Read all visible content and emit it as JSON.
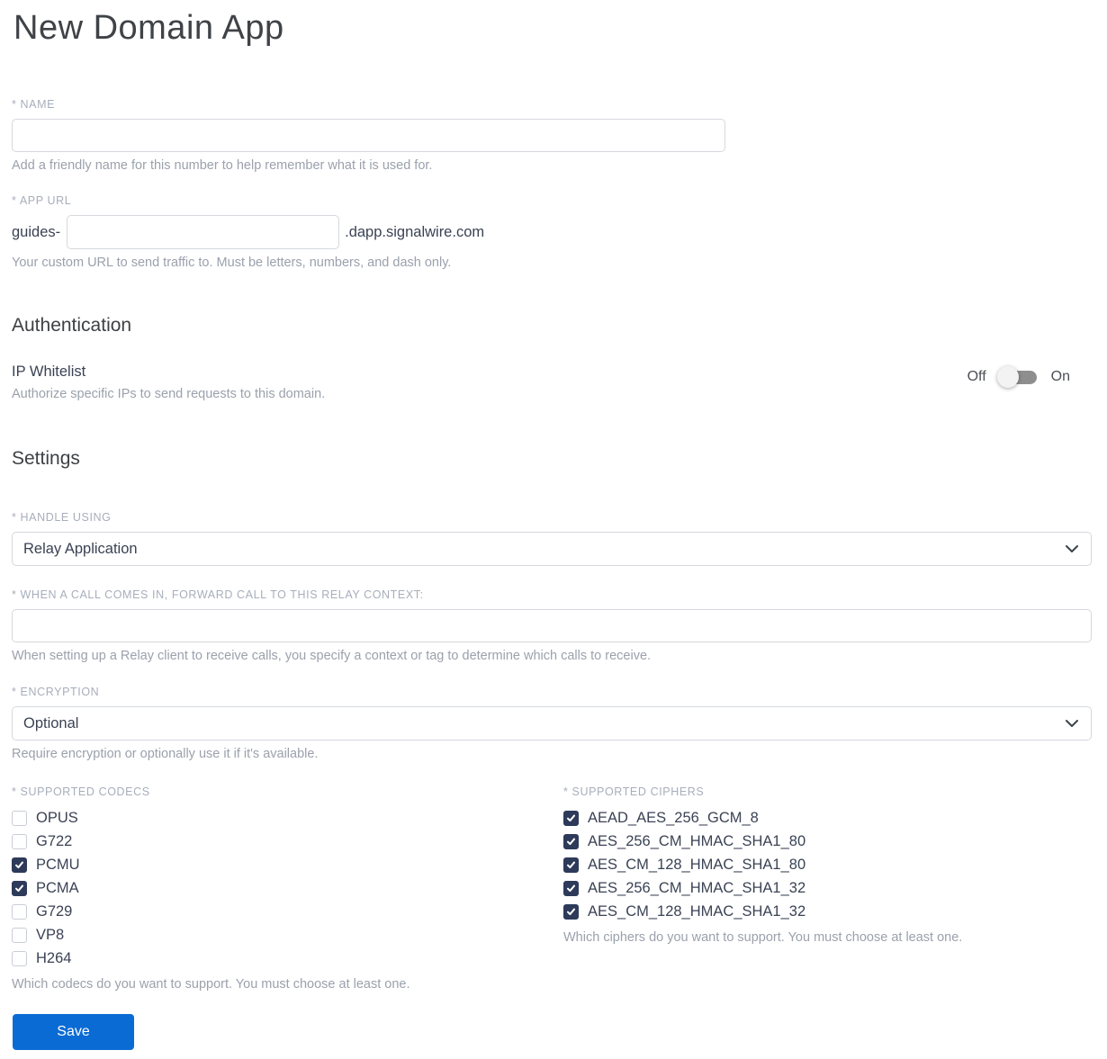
{
  "page": {
    "title": "New Domain App"
  },
  "colors": {
    "accent_blue": "#0b6bd4",
    "checkbox_checked": "#2d3a5a",
    "toggle_track": "#8e8e8e",
    "label_gray": "#a7aebb",
    "help_gray": "#9ba1ac",
    "text_dark": "#3a4254"
  },
  "name_field": {
    "label": "* NAME",
    "value": "",
    "help": "Add a friendly name for this number to help remember what it is used for."
  },
  "app_url_field": {
    "label": "* APP URL",
    "prefix": "guides-",
    "value": "",
    "suffix": ".dapp.signalwire.com",
    "help": "Your custom URL to send traffic to. Must be letters, numbers, and dash only."
  },
  "authentication": {
    "heading": "Authentication",
    "ip_whitelist": {
      "label": "IP Whitelist",
      "help": "Authorize specific IPs to send requests to this domain.",
      "off_label": "Off",
      "on_label": "On",
      "state": "off"
    }
  },
  "settings": {
    "heading": "Settings",
    "handle_using": {
      "label": "* HANDLE USING",
      "value": "Relay Application"
    },
    "relay_context": {
      "label": "* WHEN A CALL COMES IN, FORWARD CALL TO THIS RELAY CONTEXT:",
      "value": "",
      "help": "When setting up a Relay client to receive calls, you specify a context or tag to determine which calls to receive."
    },
    "encryption": {
      "label": "* ENCRYPTION",
      "value": "Optional",
      "help": "Require encryption or optionally use it if it's available."
    },
    "codecs": {
      "label": "* SUPPORTED CODECS",
      "items": [
        {
          "label": "OPUS",
          "checked": false
        },
        {
          "label": "G722",
          "checked": false
        },
        {
          "label": "PCMU",
          "checked": true
        },
        {
          "label": "PCMA",
          "checked": true
        },
        {
          "label": "G729",
          "checked": false
        },
        {
          "label": "VP8",
          "checked": false
        },
        {
          "label": "H264",
          "checked": false
        }
      ],
      "help": "Which codecs do you want to support. You must choose at least one."
    },
    "ciphers": {
      "label": "* SUPPORTED CIPHERS",
      "items": [
        {
          "label": "AEAD_AES_256_GCM_8",
          "checked": true
        },
        {
          "label": "AES_256_CM_HMAC_SHA1_80",
          "checked": true
        },
        {
          "label": "AES_CM_128_HMAC_SHA1_80",
          "checked": true
        },
        {
          "label": "AES_256_CM_HMAC_SHA1_32",
          "checked": true
        },
        {
          "label": "AES_CM_128_HMAC_SHA1_32",
          "checked": true
        }
      ],
      "help": "Which ciphers do you want to support. You must choose at least one."
    }
  },
  "actions": {
    "save_label": "Save"
  }
}
